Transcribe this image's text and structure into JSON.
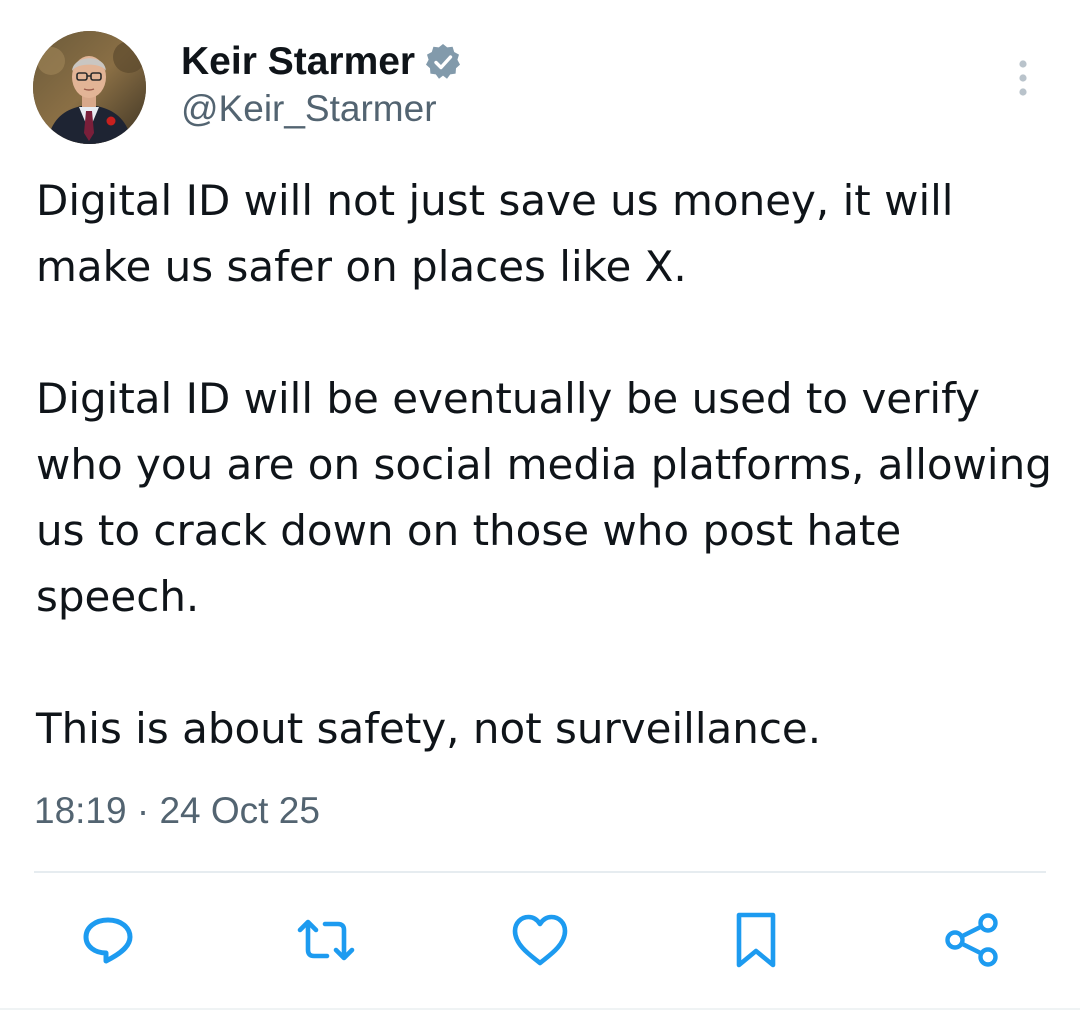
{
  "author": {
    "display_name": "Keir Starmer",
    "handle": "@Keir_Starmer",
    "verified": true,
    "verified_color": "#829aab"
  },
  "tweet": {
    "paragraphs": [
      "Digital ID will not just save us money, it will make us safer on places like X.",
      "Digital ID will be eventually be used to verify who you are on social media platforms, allowing us to crack down on those who post hate speech.",
      "This is about safety, not surveillance."
    ],
    "timestamp": "18:19 · 24 Oct 25"
  },
  "actions": [
    {
      "icon": "reply-icon"
    },
    {
      "icon": "retweet-icon"
    },
    {
      "icon": "like-icon"
    },
    {
      "icon": "bookmark-icon"
    },
    {
      "icon": "share-icon"
    }
  ],
  "colors": {
    "text": "#0f1419",
    "secondary": "#536471",
    "divider": "#e6ecf0"
  }
}
